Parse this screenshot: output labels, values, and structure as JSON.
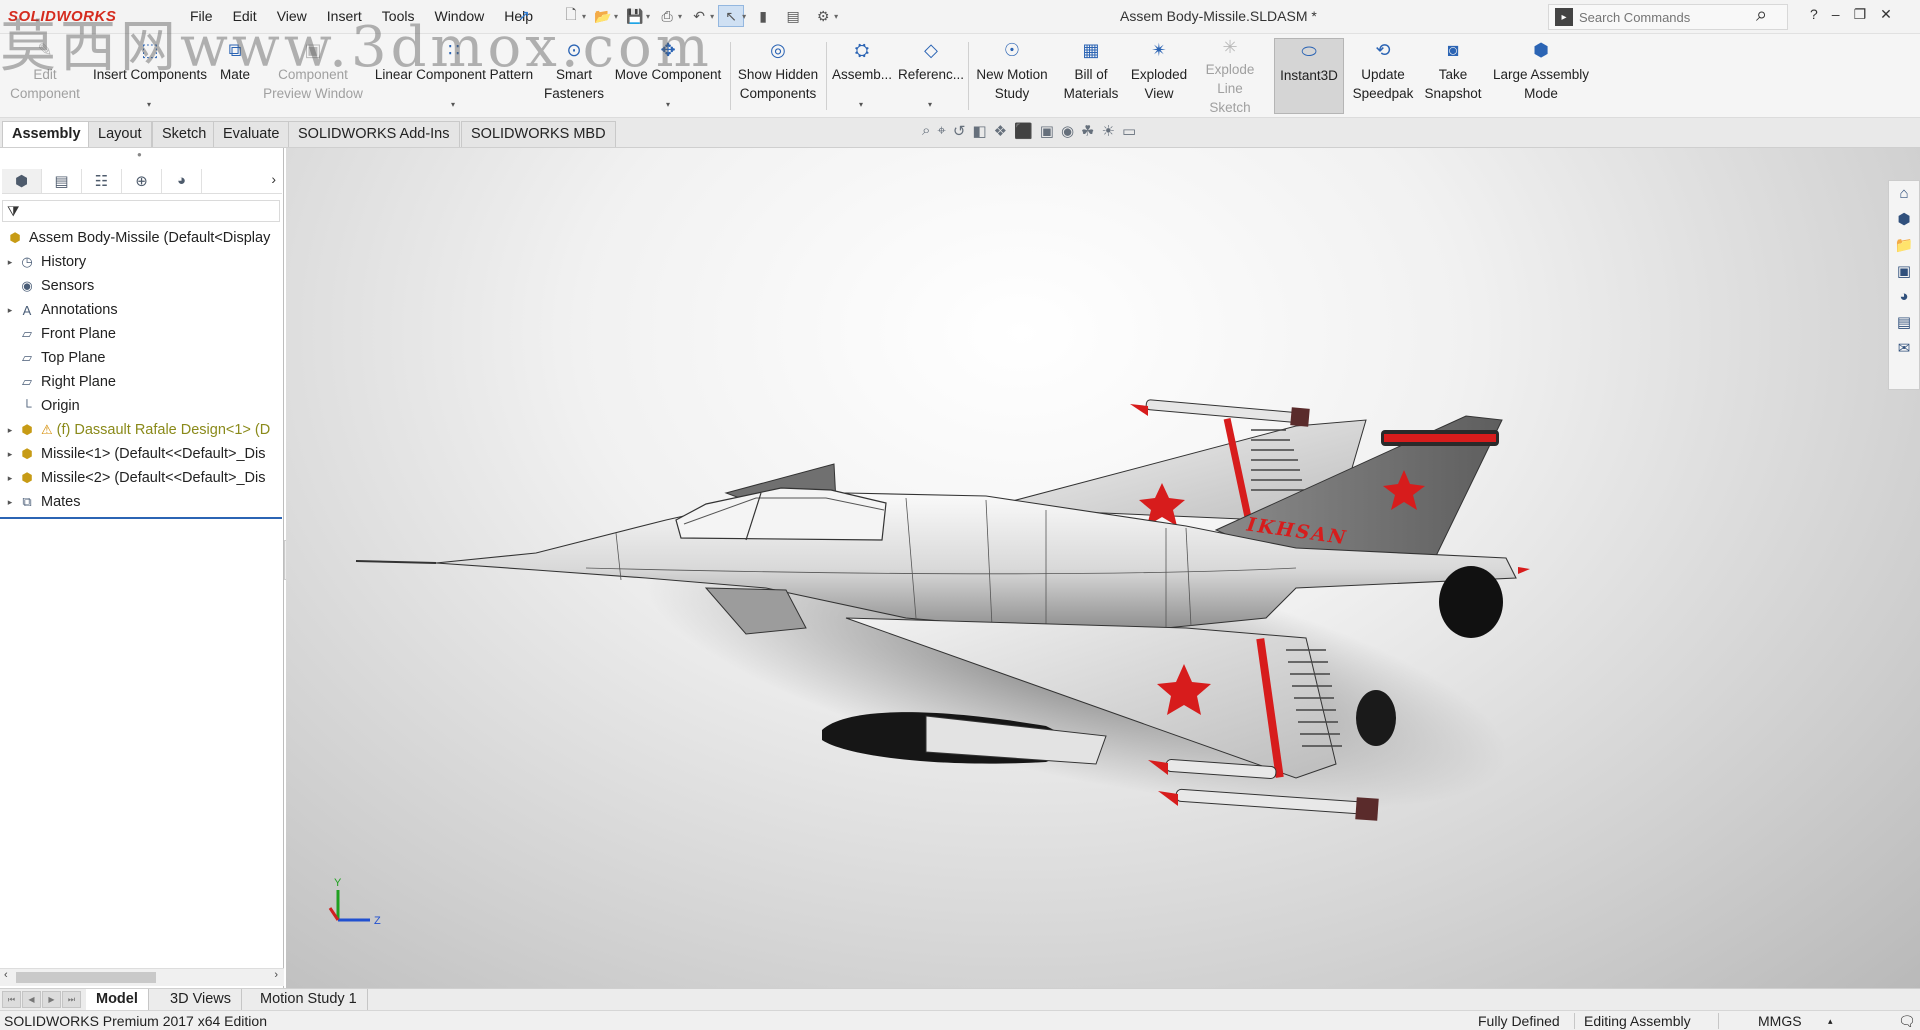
{
  "app": {
    "logo": "SOLIDWORKS",
    "document_title": "Assem Body-Missile.SLDASM *",
    "watermark": "莫西网www.3dmox.com"
  },
  "menu": [
    "File",
    "Edit",
    "View",
    "Insert",
    "Tools",
    "Window",
    "Help"
  ],
  "search": {
    "placeholder": "Search Commands"
  },
  "ribbon": {
    "edit_component": "Edit Component",
    "insert_components": "Insert Components",
    "mate": "Mate",
    "component_preview": "Component Preview Window",
    "linear_pattern": "Linear Component Pattern",
    "smart_fasteners": "Smart Fasteners",
    "move_component": "Move Component",
    "show_hidden": "Show Hidden Components",
    "assembly": "Assemb...",
    "reference": "Referenc...",
    "motion_study": "New Motion Study",
    "bom": "Bill of Materials",
    "exploded_view": "Exploded View",
    "explode_line": "Explode Line Sketch",
    "instant3d": "Instant3D",
    "update_speedpak": "Update Speedpak",
    "snapshot": "Take Snapshot",
    "large_assembly": "Large Assembly Mode"
  },
  "tabs": [
    "Assembly",
    "Layout",
    "Sketch",
    "Evaluate",
    "SOLIDWORKS Add-Ins",
    "SOLIDWORKS MBD"
  ],
  "tree": {
    "root": "Assem Body-Missile  (Default<Display",
    "items": [
      "History",
      "Sensors",
      "Annotations",
      "Front Plane",
      "Top Plane",
      "Right Plane",
      "Origin",
      "(f) Dassault Rafale Design<1> (D",
      "Missile<1> (Default<<Default>_Dis",
      "Missile<2> (Default<<Default>_Dis",
      "Mates"
    ]
  },
  "model": {
    "tail_text": "IKHSAN",
    "triad": {
      "y": "Y",
      "z": "Z"
    },
    "colors": {
      "accent": "#d71c1c",
      "body": "#e8e8e8",
      "dark": "#5a5a5a"
    }
  },
  "bottom_tabs": [
    "Model",
    "3D Views",
    "Motion Study 1"
  ],
  "status": {
    "edition": "SOLIDWORKS Premium 2017 x64 Edition",
    "defined": "Fully Defined",
    "mode": "Editing Assembly",
    "units": "MMGS"
  }
}
